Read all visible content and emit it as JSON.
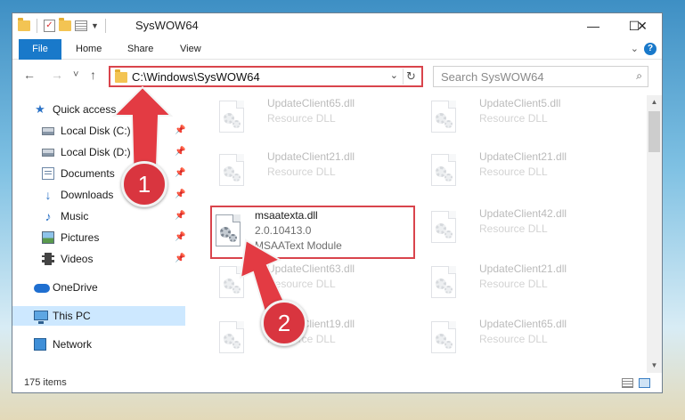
{
  "window": {
    "title": "SysWOW64",
    "controls": {
      "minimize": "—",
      "maximize": "☐",
      "close": "✕"
    }
  },
  "ribbon": {
    "tabs": [
      "File",
      "Home",
      "Share",
      "View"
    ],
    "help": "?"
  },
  "navigation": {
    "back": "←",
    "forward": "→",
    "recent": "˅",
    "up": "↑",
    "address": "C:\\Windows\\SysWOW64",
    "refresh": "↻",
    "search_placeholder": "Search SysWOW64"
  },
  "sidebar": {
    "items": [
      {
        "label": "Quick access",
        "icon": "star-icon"
      },
      {
        "label": "Local Disk (C:)",
        "icon": "disk-icon",
        "pinned": true
      },
      {
        "label": "Local Disk (D:)",
        "icon": "disk-icon",
        "pinned": true
      },
      {
        "label": "Documents",
        "icon": "documents-icon",
        "pinned": true
      },
      {
        "label": "Downloads",
        "icon": "download-icon",
        "pinned": true
      },
      {
        "label": "Music",
        "icon": "music-icon",
        "pinned": true
      },
      {
        "label": "Pictures",
        "icon": "pictures-icon",
        "pinned": true
      },
      {
        "label": "Videos",
        "icon": "videos-icon",
        "pinned": true
      },
      {
        "label": "OneDrive",
        "icon": "onedrive-icon"
      },
      {
        "label": "This PC",
        "icon": "computer-icon",
        "selected": true
      },
      {
        "label": "Network",
        "icon": "network-icon"
      }
    ]
  },
  "files": [
    {
      "name": "UpdateClient65.dll",
      "line2": "Resource DLL",
      "line3": ""
    },
    {
      "name": "UpdateClient5.dll",
      "line2": "Resource DLL",
      "line3": ""
    },
    {
      "name": "UpdateClient21.dll",
      "line2": "Resource DLL",
      "line3": ""
    },
    {
      "name": "UpdateClient21.dll",
      "line2": "Resource DLL",
      "line3": ""
    },
    {
      "name": "msaatexta.dll",
      "line2": "2.0.10413.0",
      "line3": "MSAAText Module"
    },
    {
      "name": "UpdateClient42.dll",
      "line2": "Resource DLL",
      "line3": ""
    },
    {
      "name": "UpdateClient63.dll",
      "line2": "Resource DLL",
      "line3": ""
    },
    {
      "name": "UpdateClient21.dll",
      "line2": "Resource DLL",
      "line3": ""
    },
    {
      "name": "UpdateClient19.dll",
      "line2": "Resource DLL",
      "line3": ""
    },
    {
      "name": "UpdateClient65.dll",
      "line2": "Resource DLL",
      "line3": ""
    }
  ],
  "status": {
    "item_count": "175 items"
  },
  "annotations": {
    "step1": "1",
    "step2": "2"
  },
  "colors": {
    "accent": "#1979ca",
    "highlight": "#d9444c",
    "badge": "#d9353f"
  }
}
